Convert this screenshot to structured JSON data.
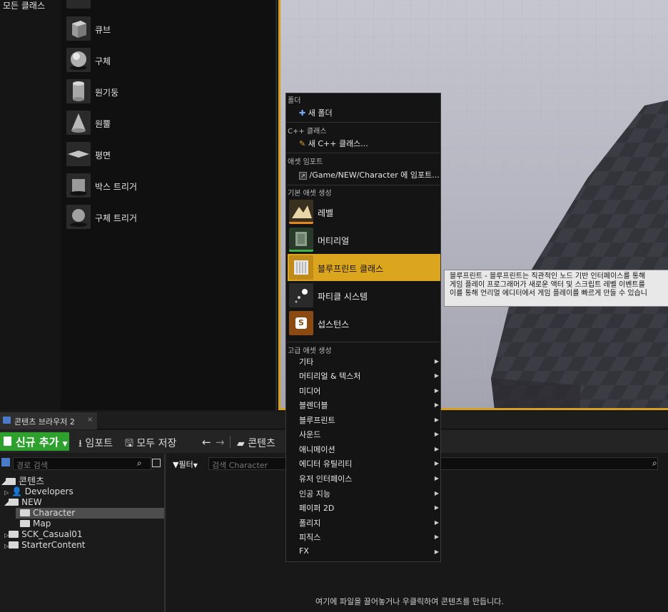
{
  "place_panel": {
    "category": "모든 클래스",
    "items": [
      "큐브",
      "구체",
      "원기둥",
      "원뿔",
      "평면",
      "박스 트리거",
      "구체 트리거"
    ]
  },
  "content_browser": {
    "tab_label": "콘텐츠 브라우저 2",
    "add_new_label": "신규 추가",
    "import_label": "임포트",
    "save_all_label": "모두 저장",
    "path_label": "콘텐츠",
    "path_search_placeholder": "경로 검색",
    "filter_label": "필터",
    "asset_search_placeholder": "검색 Character",
    "tree": {
      "root": "콘텐츠",
      "developers": "Developers",
      "new_folder": "NEW",
      "character": "Character",
      "map": "Map",
      "sck": "SCK_Casual01",
      "starter": "StarterContent"
    },
    "empty_hint": "여기에 파일을 끌어놓거나 우클릭하여 콘텐츠를 만듭니다."
  },
  "context_menu": {
    "folder_section": "폴더",
    "new_folder": "새 폴더",
    "cpp_section": "C++ 클래스",
    "new_cpp": "새 C++ 클래스...",
    "import_section": "애셋 임포트",
    "import_to": "/Game/NEW/Character 에 임포트...",
    "basic_section": "기본 애셋 생성",
    "level": "레벨",
    "material": "머티리얼",
    "blueprint_class": "블루프린트 클래스",
    "particle_system": "파티클 시스템",
    "substance": "섭스턴스",
    "advanced_section": "고급 애셋 생성",
    "submenus": [
      "기타",
      "머티리얼 & 텍스처",
      "미디어",
      "블렌더블",
      "블루프린트",
      "사운드",
      "애니메이션",
      "에디터 유틸리티",
      "유저 인터페이스",
      "인공 지능",
      "페이퍼 2D",
      "폴리지",
      "피직스",
      "FX"
    ]
  },
  "tooltip": {
    "line1": "블루프린트 - 블루프린트는 직관적인 노드 기반 인터페이스를 통해",
    "line2": "게임 플레이 프로그래머가 새로운 액터 및 스크립트 레벨 이벤트를",
    "line3": "이를 통해 언리얼 에디터에서 게임 플레이를 빠르게 만들 수 있습니"
  },
  "colors": {
    "accent_orange": "#dba51d",
    "add_new_green": "#2ea02e"
  }
}
